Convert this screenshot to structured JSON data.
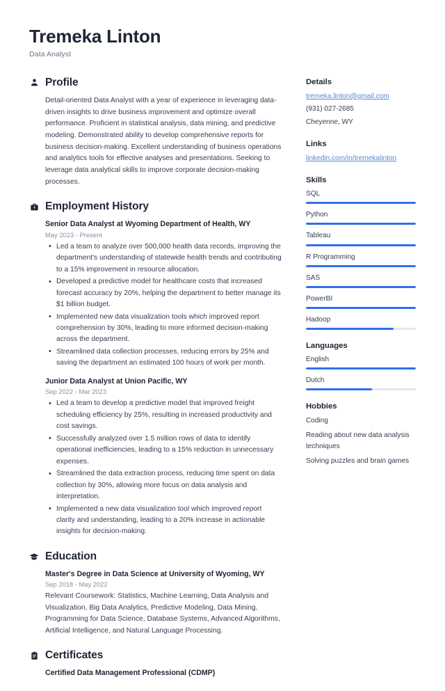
{
  "header": {
    "name": "Tremeka Linton",
    "title": "Data Analyst"
  },
  "main": {
    "profile": {
      "icon": "user-icon",
      "heading": "Profile",
      "text": "Detail-oriented Data Analyst with a year of experience in leveraging data-driven insights to drive business improvement and optimize overall performance. Proficient in statistical analysis, data mining, and predictive modeling. Demonstrated ability to develop comprehensive reports for business decision-making. Excellent understanding of business operations and analytics tools for effective analyses and presentations. Seeking to leverage data analytical skills to improve corporate decision-making processes."
    },
    "employment": {
      "icon": "briefcase-icon",
      "heading": "Employment History",
      "entries": [
        {
          "title": "Senior Data Analyst at Wyoming Department of Health, WY",
          "date": "May 2023 - Present",
          "bullets": [
            "Led a team to analyze over 500,000 health data records, improving the department's understanding of statewide health trends and contributing to a 15% improvement in resource allocation.",
            "Developed a predictive model for healthcare costs that increased forecast accuracy by 20%, helping the department to better manage its $1 billion budget.",
            "Implemented new data visualization tools which improved report comprehension by 30%, leading to more informed decision-making across the department.",
            "Streamlined data collection processes, reducing errors by 25% and saving the department an estimated 100 hours of work per month."
          ]
        },
        {
          "title": "Junior Data Analyst at Union Pacific, WY",
          "date": "Sep 2022 - Mar 2023",
          "bullets": [
            "Led a team to develop a predictive model that improved freight scheduling efficiency by 25%, resulting in increased productivity and cost savings.",
            "Successfully analyzed over 1.5 million rows of data to identify operational inefficiencies, leading to a 15% reduction in unnecessary expenses.",
            "Streamlined the data extraction process, reducing time spent on data collection by 30%, allowing more focus on data analysis and interpretation.",
            "Implemented a new data visualization tool which improved report clarity and understanding, leading to a 20% increase in actionable insights for decision-making."
          ]
        }
      ]
    },
    "education": {
      "icon": "graduation-cap-icon",
      "heading": "Education",
      "entries": [
        {
          "title": "Master's Degree in Data Science at University of Wyoming, WY",
          "date": "Sep 2018 - May 2022",
          "description": "Relevant Coursework: Statistics, Machine Learning, Data Analysis and Visualization, Big Data Analytics, Predictive Modeling, Data Mining, Programming for Data Science, Database Systems, Advanced Algorithms, Artificial Intelligence, and Natural Language Processing."
        }
      ]
    },
    "certificates": {
      "icon": "clipboard-icon",
      "heading": "Certificates",
      "entries": [
        {
          "title": "Certified Data Management Professional (CDMP)"
        }
      ]
    }
  },
  "sidebar": {
    "details": {
      "heading": "Details",
      "email": "tremeka.linton@gmail.com",
      "phone": "(931) 027-2685",
      "location": "Cheyenne, WY"
    },
    "links": {
      "heading": "Links",
      "items": [
        {
          "label": "linkedin.com/in/tremekalinton"
        }
      ]
    },
    "skills": {
      "heading": "Skills",
      "items": [
        {
          "label": "SQL",
          "level": 100
        },
        {
          "label": "Python",
          "level": 100
        },
        {
          "label": "Tableau",
          "level": 100
        },
        {
          "label": "R Programming",
          "level": 100
        },
        {
          "label": "SAS",
          "level": 100
        },
        {
          "label": "PowerBI",
          "level": 100
        },
        {
          "label": "Hadoop",
          "level": 80
        }
      ]
    },
    "languages": {
      "heading": "Languages",
      "items": [
        {
          "label": "English",
          "level": 100
        },
        {
          "label": "Dutch",
          "level": 60
        }
      ]
    },
    "hobbies": {
      "heading": "Hobbies",
      "items": [
        {
          "label": "Coding"
        },
        {
          "label": "Reading about new data analysis techniques"
        },
        {
          "label": "Solving puzzles and brain games"
        }
      ]
    }
  },
  "colors": {
    "accent": "#2f6fed",
    "link": "#5b86d6",
    "heading": "#1f2535",
    "text": "#363d51",
    "muted": "#8a8f9d",
    "track": "#e6e7ea"
  }
}
